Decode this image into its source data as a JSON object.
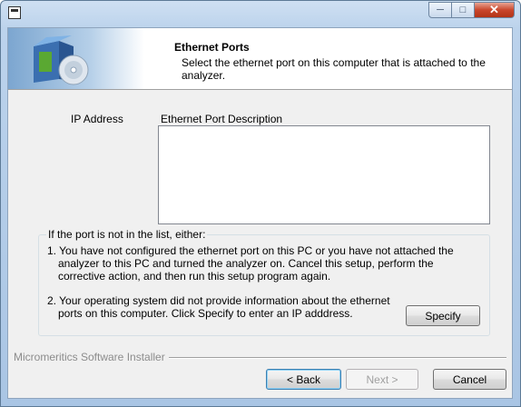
{
  "header": {
    "title": "Ethernet Ports",
    "subtitle": "Select the ethernet port on this computer that is attached to the analyzer."
  },
  "columns": {
    "ip_address": "IP Address",
    "description": "Ethernet Port Description"
  },
  "ports": [],
  "help": {
    "caption": "If the port is not in the list, either:",
    "items": [
      "1. You have not configured the ethernet port on this PC or you have not attached the",
      "analyzer to this PC and turned the analyzer on. Cancel this setup, perform the",
      "corrective action, and then run this setup program again.",
      "2. Your operating system did not provide information about the ethernet",
      "ports on this computer. Click Specify to enter an IP adddress."
    ]
  },
  "buttons": {
    "specify": "Specify",
    "back": "< Back",
    "next": "Next >",
    "cancel": "Cancel"
  },
  "footer": {
    "installer_label": "Micromeritics Software Installer"
  },
  "colors": {
    "title_bar": "#bcd3ec",
    "close_button": "#c9462c",
    "dialog_face": "#f0f0f0"
  }
}
